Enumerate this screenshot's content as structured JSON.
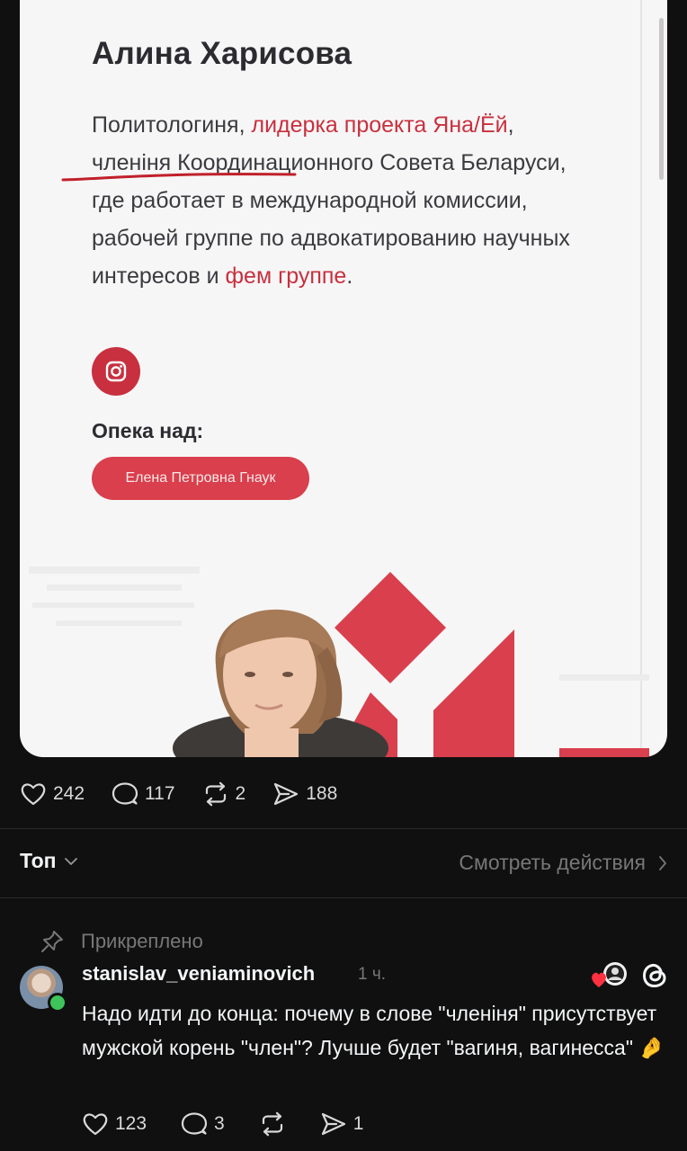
{
  "post_image": {
    "name": "Алина Харисова",
    "bio_parts": [
      {
        "text": "Политологиня, ",
        "red": false
      },
      {
        "text": "лидерка проекта Яна/Ёй",
        "red": true
      },
      {
        "text": ", членіня Координационного Совета Беларуси, где работает в международной комиссии, рабочей группе по адвокатированию научных интересов и ",
        "red": false
      },
      {
        "text": "фем группе",
        "red": true
      },
      {
        "text": ".",
        "red": false
      }
    ],
    "instagram_icon": "instagram-icon",
    "opeka_label": "Опека над:",
    "ward_chip": "Елена Петровна Гнаук"
  },
  "post_actions": {
    "likes": "242",
    "comments": "117",
    "reposts": "2",
    "shares": "188"
  },
  "sort": {
    "label": "Топ",
    "see_activity": "Смотреть действия"
  },
  "comment": {
    "pinned_label": "Прикреплено",
    "username": "stanislav_veniaminovich",
    "time": "1 ч.",
    "text": "Надо идти до конца: почему в слове \"членіня\" присутствует мужской корень \"член\"? Лучше будет \"вагиня, вагинесса\" 🤌",
    "likes": "123",
    "replies": "3",
    "shares": "1"
  },
  "colors": {
    "accent_red": "#c8303f",
    "background": "#101010",
    "online": "#3ec45a"
  }
}
